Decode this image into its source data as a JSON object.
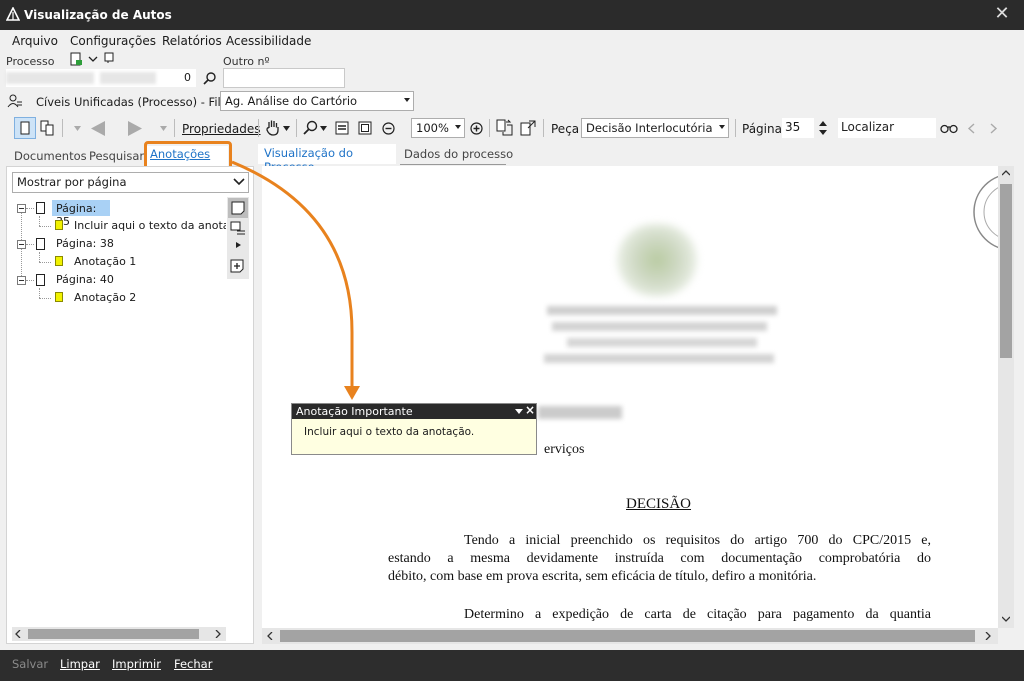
{
  "window": {
    "title": "Visualização de Autos",
    "close_glyph": "✕"
  },
  "menu": [
    "Arquivo",
    "Configurações",
    "Relatórios",
    "Acessibilidade"
  ],
  "filters": {
    "processo_label": "Processo",
    "processo_value_suffix": "0",
    "outro_label": "Outro nº",
    "outro_value": ""
  },
  "queue": {
    "text": "Cíveis Unificadas (Processo) - Fila:",
    "selected": "Ag. Análise do Cartório"
  },
  "toolbar": {
    "propriedades_label": "Propriedades",
    "zoom_value": "100%",
    "peca_label": "Peça",
    "peca_value": "Decisão Interlocutória",
    "pagina_label": "Página",
    "pagina_value": "35",
    "localizar_placeholder": "Localizar"
  },
  "left_tabs": [
    "Documentos",
    "Pesquisar",
    "Anotações"
  ],
  "right_tabs": [
    "Visualização do Processo",
    "Dados do processo"
  ],
  "view_mode": {
    "selected": "Mostrar por página"
  },
  "tree": {
    "pages": [
      {
        "label": "Página: 35",
        "notes": [
          "Incluir aqui o texto da anotaçã"
        ]
      },
      {
        "label": "Página: 38",
        "notes": [
          "Anotação 1"
        ]
      },
      {
        "label": "Página: 40",
        "notes": [
          "Anotação 2"
        ]
      }
    ]
  },
  "popup": {
    "title": "Anotação Importante",
    "text": "Incluir aqui o texto da anotação.",
    "close_glyph": "×"
  },
  "document": {
    "fragment": "erviços",
    "heading": "DECISÃO",
    "para1_lines": [
      "Tendo a inicial preenchido os requisitos do artigo 700 do CPC/2015 e,",
      "estando a mesma devidamente instruída com documentação comprobatória do",
      "débito, com base em prova escrita, sem eficácia de título, defiro a monitória."
    ],
    "para2_line": "Determino a expedição de carta de citação para pagamento da quantia"
  },
  "bottom": [
    "Salvar",
    "Limpar",
    "Imprimir",
    "Fechar"
  ],
  "colors": {
    "highlight": "#e8821e",
    "tab_active": "#1f73c7",
    "titlebar": "#2b2b2b",
    "selection": "#a9d1f5",
    "note": "#f1f200"
  }
}
